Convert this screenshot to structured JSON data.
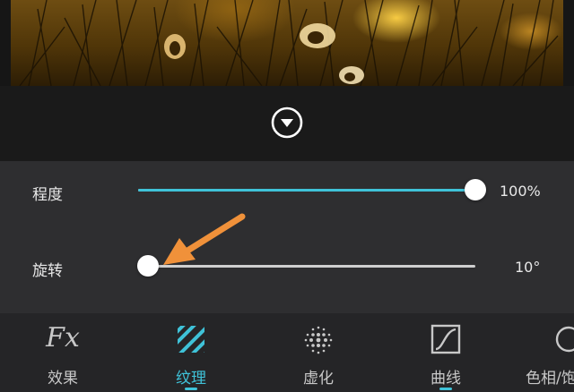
{
  "sliders": [
    {
      "label": "程度",
      "value_text": "100%",
      "value": 1.0
    },
    {
      "label": "旋转",
      "value_text": "10°",
      "value": 0.03
    }
  ],
  "colors": {
    "accent": "#3fc2d8",
    "annotation_arrow": "#f0913a",
    "panel_bg": "#2e2e30",
    "tabbar_bg": "#252527"
  },
  "tabs": [
    {
      "label": "效果",
      "icon": "fx-icon",
      "active": false,
      "icon_text": "Fx"
    },
    {
      "label": "纹理",
      "icon": "texture-stripes-icon",
      "active": true
    },
    {
      "label": "虚化",
      "icon": "blur-dots-icon",
      "active": false
    },
    {
      "label": "曲线",
      "icon": "curve-icon",
      "active": false
    },
    {
      "label": "色相/饱",
      "icon": "hue-icon",
      "active": false
    }
  ],
  "icons": {
    "collapse": "chevron-down-circle-icon",
    "annotation": "arrow-annotation-icon"
  }
}
